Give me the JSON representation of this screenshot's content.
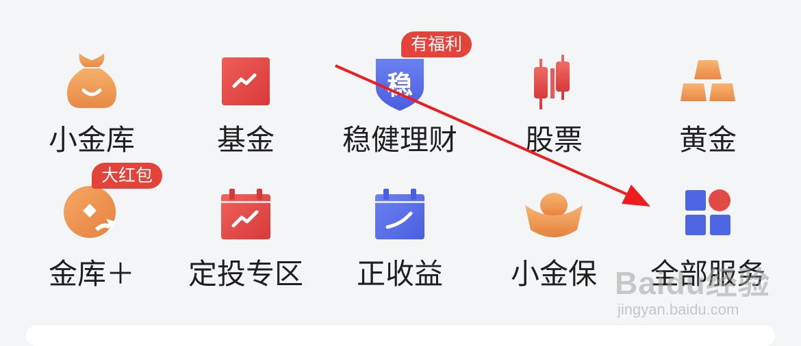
{
  "grid": {
    "items": [
      {
        "label": "小金库",
        "icon": "money-bag-icon"
      },
      {
        "label": "基金",
        "icon": "fund-chart-icon"
      },
      {
        "label": "稳健理财",
        "icon": "shield-wen-icon",
        "icon_text": "稳",
        "badge": "有福利"
      },
      {
        "label": "股票",
        "icon": "candlestick-icon"
      },
      {
        "label": "黄金",
        "icon": "gold-bars-icon"
      },
      {
        "label": "金库＋",
        "icon": "coin-plus-icon",
        "badge": "大红包"
      },
      {
        "label": "定投专区",
        "icon": "calendar-chart-icon"
      },
      {
        "label": "正收益",
        "icon": "calendar-curve-icon"
      },
      {
        "label": "小金保",
        "icon": "gold-ingot-icon"
      },
      {
        "label": "全部服务",
        "icon": "all-services-grid-icon"
      }
    ]
  },
  "watermark": {
    "logo": "Baidu经验",
    "url": "jingyan.baidu.com"
  },
  "colors": {
    "background": "#f4f5f7",
    "badge": "#e4433a",
    "orange": "#ef9a55",
    "red": "#e24a45",
    "blue": "#5168e6",
    "annotation_arrow": "#ee1c1c"
  }
}
